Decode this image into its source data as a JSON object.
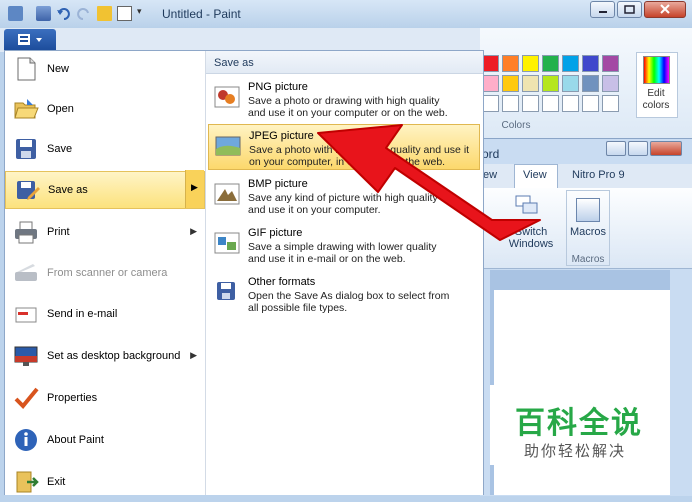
{
  "window": {
    "title": "Untitled - Paint"
  },
  "colors_group": {
    "label": "Colors",
    "edit_colors": "Edit\ncolors",
    "swatches": [
      "#ed1c24",
      "#ff7f27",
      "#fff200",
      "#22b14c",
      "#00a2e8",
      "#3f48cc",
      "#a349a4",
      "#ffaec9",
      "#ffc90e",
      "#efe4b0",
      "#b5e61d",
      "#99d9ea",
      "#7092be",
      "#c8bfe7",
      "#ffffff",
      "#ffffff",
      "#ffffff",
      "#ffffff",
      "#ffffff",
      "#ffffff",
      "#ffffff"
    ]
  },
  "word_window": {
    "title_fragment": "ord",
    "tabs": [
      "ew",
      "View",
      "Nitro Pro 9"
    ],
    "switch_windows": "Switch\nWindows",
    "macros": "Macros",
    "macros_group": "Macros"
  },
  "menu": {
    "items": [
      {
        "label": "New"
      },
      {
        "label": "Open"
      },
      {
        "label": "Save"
      },
      {
        "label": "Save as"
      },
      {
        "label": "Print"
      },
      {
        "label": "From scanner or camera"
      },
      {
        "label": "Send in e-mail"
      },
      {
        "label": "Set as desktop background"
      },
      {
        "label": "Properties"
      },
      {
        "label": "About Paint"
      },
      {
        "label": "Exit"
      }
    ]
  },
  "save_as": {
    "header": "Save as",
    "options": [
      {
        "title": "PNG picture",
        "desc": "Save a photo or drawing with high quality\nand use it on your computer or on the web."
      },
      {
        "title": "JPEG picture",
        "desc": "Save a photo with reasonable quality and use it\non your computer, in e-mail or on the web."
      },
      {
        "title": "BMP picture",
        "desc": "Save any kind of picture with high quality\nand use it on your computer."
      },
      {
        "title": "GIF picture",
        "desc": "Save a simple drawing with lower quality\nand use it in e-mail or on the web."
      },
      {
        "title": "Other formats",
        "desc": "Open the Save As dialog box to select from\nall possible file types."
      }
    ]
  },
  "watermark": {
    "line1": "百科全说",
    "line2": "助你轻松解决"
  },
  "accent_colors": {
    "highlight": "#fce27d",
    "arrow": "#e8141b",
    "menu_button": "#1d4d9c"
  }
}
